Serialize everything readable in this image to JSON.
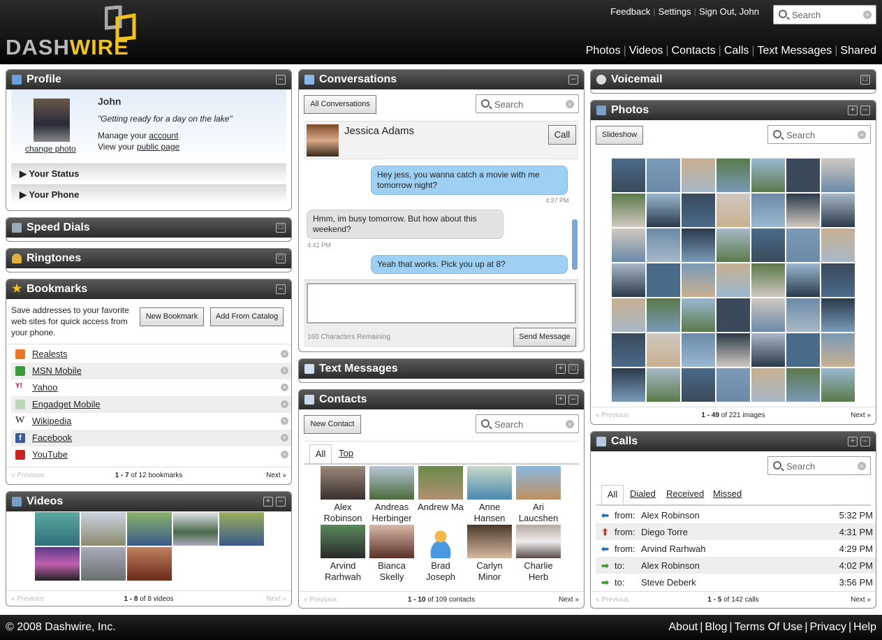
{
  "header": {
    "logo": {
      "part1": "DASH",
      "part2": "WIRE"
    },
    "top_links": [
      "Feedback",
      "Settings",
      "Sign Out, John"
    ],
    "search_placeholder": "Search",
    "nav": [
      "Photos",
      "Videos",
      "Contacts",
      "Calls",
      "Text Messages",
      "Shared"
    ]
  },
  "profile": {
    "title": "Profile",
    "name": "John",
    "quote": "\"Getting ready for a day on the lake\"",
    "manage_prefix": "Manage your ",
    "manage_link": "account",
    "view_prefix": "View your ",
    "view_link": "public page",
    "change_photo": "change photo",
    "your_status": "Your Status",
    "your_phone": "Your Phone"
  },
  "speed_dials": {
    "title": "Speed Dials"
  },
  "ringtones": {
    "title": "Ringtones"
  },
  "bookmarks": {
    "title": "Bookmarks",
    "description": "Save addresses to your favorite web sites for quick access from your phone.",
    "new_button": "New Bookmark",
    "catalog_button": "Add From Catalog",
    "items": [
      {
        "label": "Realests",
        "color": "#e8762b"
      },
      {
        "label": "MSN Mobile",
        "color": "#3a9a3a"
      },
      {
        "label": "Yahoo",
        "color": "#b0182a"
      },
      {
        "label": "Engadget Mobile",
        "color": "#7ab07a"
      },
      {
        "label": "Wikipedia",
        "color": "#444444"
      },
      {
        "label": "Facebook",
        "color": "#3b5998"
      },
      {
        "label": "YouTube",
        "color": "#cc2222"
      }
    ],
    "pager": {
      "prev": "« Previous",
      "range": "1 - 7",
      "of_text": " of 12 bookmarks",
      "next": "Next »"
    }
  },
  "videos": {
    "title": "Videos",
    "pager": {
      "prev": "« Previous",
      "range": "1 - 8",
      "of_text": " of 8 videos",
      "next": "Next »"
    }
  },
  "conversations": {
    "title": "Conversations",
    "all_button": "All Conversations",
    "search_placeholder": "Search",
    "contact_name": "Jessica Adams",
    "call_button": "Call",
    "messages": [
      {
        "text": "Hey jess, you wanna catch a movie with me tomorrow night?",
        "time": "4:37 PM",
        "side": "right"
      },
      {
        "text": "Hmm, im busy tomorrow. But how about this weekend?",
        "time": "4:41 PM",
        "side": "left"
      },
      {
        "text": "Yeah that works. Pick you up at 8?",
        "time": "",
        "side": "right"
      }
    ],
    "chars_remaining": "160 Characters Remaining",
    "send_button": "Send Message"
  },
  "text_messages": {
    "title": "Text Messages"
  },
  "contacts": {
    "title": "Contacts",
    "new_button": "New Contact",
    "search_placeholder": "Search",
    "tabs": [
      "All",
      "Top"
    ],
    "items": [
      {
        "first": "Alex",
        "last": "Robinson"
      },
      {
        "first": "Andreas",
        "last": "Herbinger"
      },
      {
        "first": "Andrew Ma",
        "last": ""
      },
      {
        "first": "Anne",
        "last": "Hansen"
      },
      {
        "first": "Ari",
        "last": "Laucshen"
      },
      {
        "first": "Arvind",
        "last": "Rarhwah"
      },
      {
        "first": "Bianca",
        "last": "Skelly"
      },
      {
        "first": "Brad",
        "last": "Joseph"
      },
      {
        "first": "Carlyn",
        "last": "Minor"
      },
      {
        "first": "Charlie",
        "last": "Herb"
      }
    ],
    "pager": {
      "prev": "« Previous",
      "range": "1 - 10",
      "of_text": " of 109 contacts",
      "next": "Next »"
    }
  },
  "voicemail": {
    "title": "Voicemail"
  },
  "photos": {
    "title": "Photos",
    "slideshow_button": "Slideshow",
    "search_placeholder": "Search",
    "pager": {
      "prev": "« Previous",
      "range": "1 - 49",
      "of_text": " of 221 images",
      "next": "Next »"
    }
  },
  "calls": {
    "title": "Calls",
    "search_placeholder": "Search",
    "tabs": [
      "All",
      "Dialed",
      "Received",
      "Missed"
    ],
    "items": [
      {
        "dir": "from:",
        "name": "Alex Robinson",
        "time": "5:32 PM",
        "arrow": "⬅",
        "color": "#2a6ec0"
      },
      {
        "dir": "from:",
        "name": "Diego Torre",
        "time": "4:31 PM",
        "arrow": "⬆",
        "color": "#c0392b"
      },
      {
        "dir": "from:",
        "name": "Arvind Rarhwah",
        "time": "4:29 PM",
        "arrow": "⬅",
        "color": "#2a6ec0"
      },
      {
        "dir": "to:",
        "name": "Alex Robinson",
        "time": "4:02 PM",
        "arrow": "➡",
        "color": "#3c9a2a"
      },
      {
        "dir": "to:",
        "name": "Steve Deberk",
        "time": "3:56 PM",
        "arrow": "➡",
        "color": "#3c9a2a"
      }
    ],
    "pager": {
      "prev": "« Previous",
      "range": "1 - 5",
      "of_text": " of 142 calls",
      "next": "Next »"
    }
  },
  "footer": {
    "copyright": "© 2008 Dashwire, Inc.",
    "links": [
      "About",
      "Blog",
      "Terms Of Use",
      "Privacy",
      "Help"
    ]
  }
}
